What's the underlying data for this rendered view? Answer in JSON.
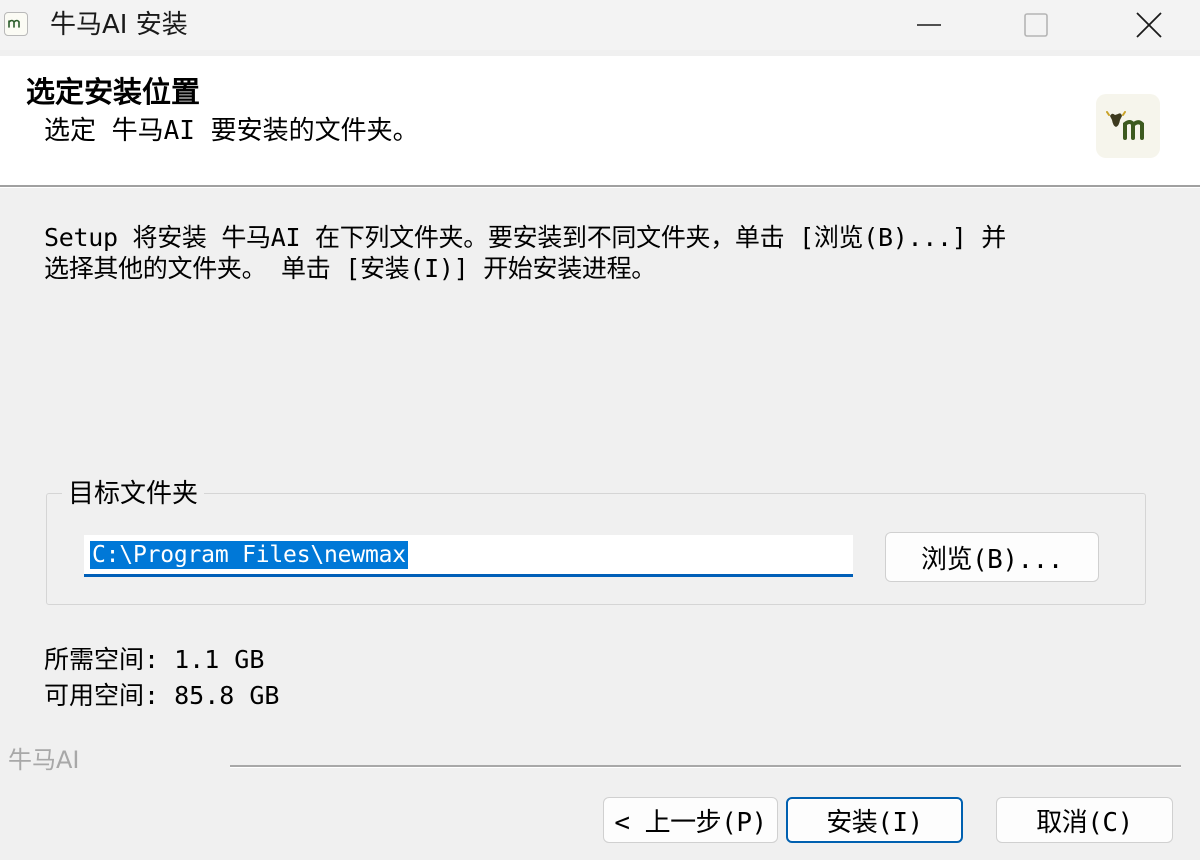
{
  "window": {
    "title": "牛马AI 安装",
    "icon": "app-logo-icon",
    "controls": [
      "minimize-icon",
      "maximize-icon",
      "close-icon"
    ]
  },
  "header": {
    "title": "选定安装位置",
    "subtitle": "选定 牛马AI 要安装的文件夹。",
    "logo": "brand-logo-icon"
  },
  "body": {
    "intro_line1": "Setup 将安装 牛马AI 在下列文件夹。要安装到不同文件夹，单击 [浏览(B)...] 并",
    "intro_line2": "选择其他的文件夹。 单击 [安装(I)] 开始安装进程。"
  },
  "destination": {
    "group_label": "目标文件夹",
    "path_value": "C:\\Program Files\\newmax",
    "browse_label": "浏览(B)..."
  },
  "space": {
    "required": "所需空间: 1.1 GB",
    "available": "可用空间: 85.8 GB"
  },
  "footer": {
    "brand": "牛马AI",
    "back_label": "< 上一步(P)",
    "install_label": "安装(I)",
    "cancel_label": "取消(C)"
  },
  "colors": {
    "accent": "#0078d7",
    "focus_border": "#005fb8",
    "background": "#f0f0f0",
    "header_background": "#ffffff"
  }
}
